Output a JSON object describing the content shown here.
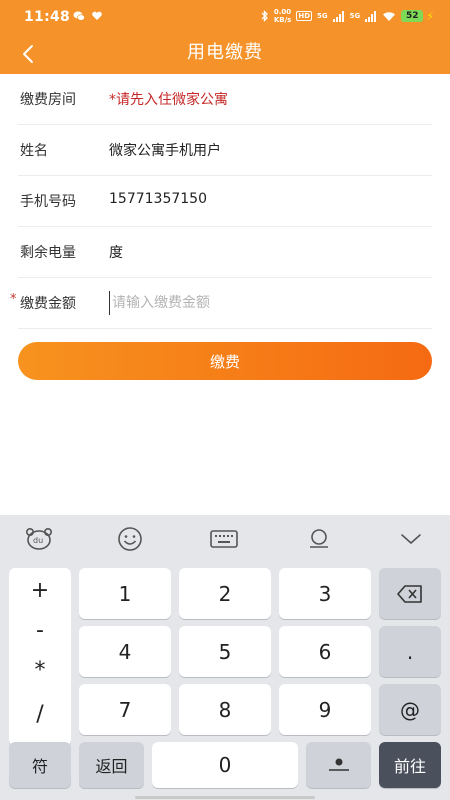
{
  "status_bar": {
    "time": "11:48",
    "net_speed": "0.00\nKB/s",
    "hd_label": "HD",
    "signal1": "5G",
    "signal2": "5G",
    "battery": "52"
  },
  "app_bar": {
    "title": "用电缴费",
    "back_icon": "chevron-left-icon"
  },
  "form": {
    "room": {
      "label": "缴费房间",
      "value": "*请先入住微家公寓"
    },
    "name": {
      "label": "姓名",
      "value": "微家公寓手机用户"
    },
    "phone": {
      "label": "手机号码",
      "value": "15771357150"
    },
    "remaining": {
      "label": "剩余电量",
      "value": "度"
    },
    "amount": {
      "required_mark": "*",
      "label": "缴费金额",
      "placeholder": "请输入缴费金额",
      "value": ""
    }
  },
  "pay_button": {
    "label": "缴费"
  },
  "keyboard": {
    "toolbar": [
      "bear-logo-icon",
      "emoji-icon",
      "keyboard-icon",
      "microphone-icon",
      "chevron-down-icon"
    ],
    "side_symbols": [
      "+",
      "-",
      "*",
      "/"
    ],
    "digits": [
      "1",
      "2",
      "3",
      "4",
      "5",
      "6",
      "7",
      "8",
      "9",
      "0"
    ],
    "dot": ".",
    "at": "@",
    "symbols_key": "符",
    "return_key": "返回",
    "go_key": "前往",
    "backspace_icon": "backspace-icon",
    "space_icon": "space-icon"
  },
  "colors": {
    "accent": "#f5932a",
    "button_gradient_end": "#f56a12",
    "warning": "#c62828"
  }
}
